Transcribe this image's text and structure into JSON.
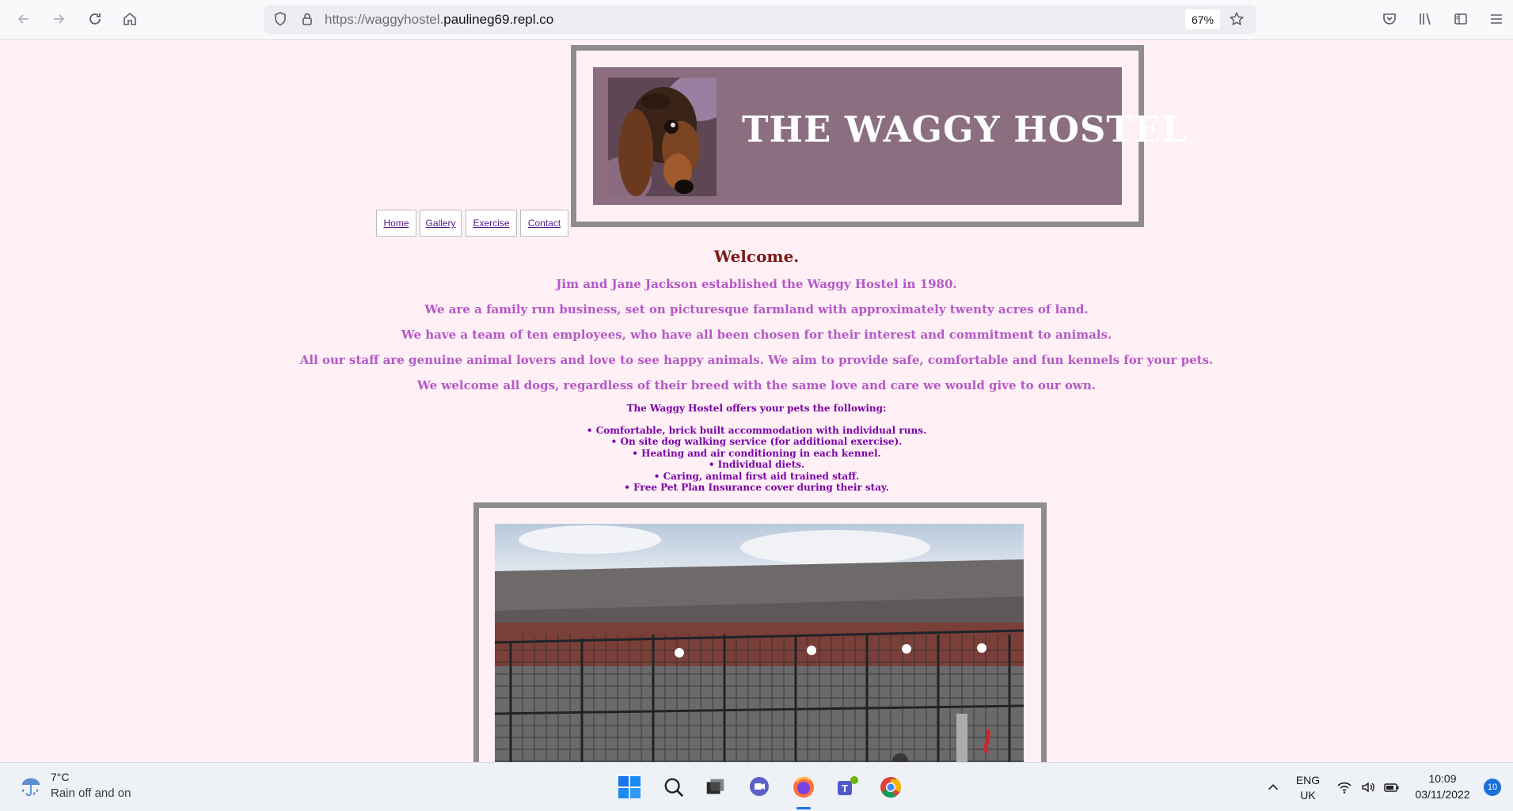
{
  "browser": {
    "url_prefix": "https://waggyhostel.",
    "url_domain": "paulineg69.repl.co",
    "zoom": "67%"
  },
  "site": {
    "title": "THE WAGGY HOSTEL",
    "nav": [
      "Home",
      "Gallery",
      "Exercise",
      "Contact"
    ],
    "welcome": "Welcome.",
    "paragraphs": [
      "Jim and Jane Jackson established the Waggy Hostel in 1980.",
      "We are a family run business, set on picturesque farmland with approximately twenty acres of land.",
      "We have a team of ten employees, who have all been chosen for their interest and commitment to animals.",
      "All our staff are genuine animal lovers and love to see happy animals. We aim to provide safe, comfortable and fun kennels for your pets.",
      "We welcome all dogs, regardless of their breed with the same love and care we would give to our own."
    ],
    "offers_heading": "The Waggy Hostel offers your pets the following:",
    "features": [
      "Comfortable, brick built accommodation with individual runs.",
      "On site dog walking service (for additional exercise).",
      "Heating and air conditioning in each kennel.",
      "Individual diets.",
      "Caring, animal first aid trained staff.",
      "Free Pet Plan Insurance cover during their stay."
    ]
  },
  "taskbar": {
    "temperature": "7°C",
    "weather": "Rain off and on",
    "language": "ENG",
    "region": "UK",
    "time": "10:09",
    "date": "03/11/2022",
    "notifications": "10"
  },
  "colors": {
    "page_bg": "#fff0f5",
    "header_bg": "#8b6f80",
    "frame": "#8d8d8d",
    "welcome": "#7b1a1a",
    "paragraph": "#b557c8",
    "list": "#7a00a8"
  }
}
